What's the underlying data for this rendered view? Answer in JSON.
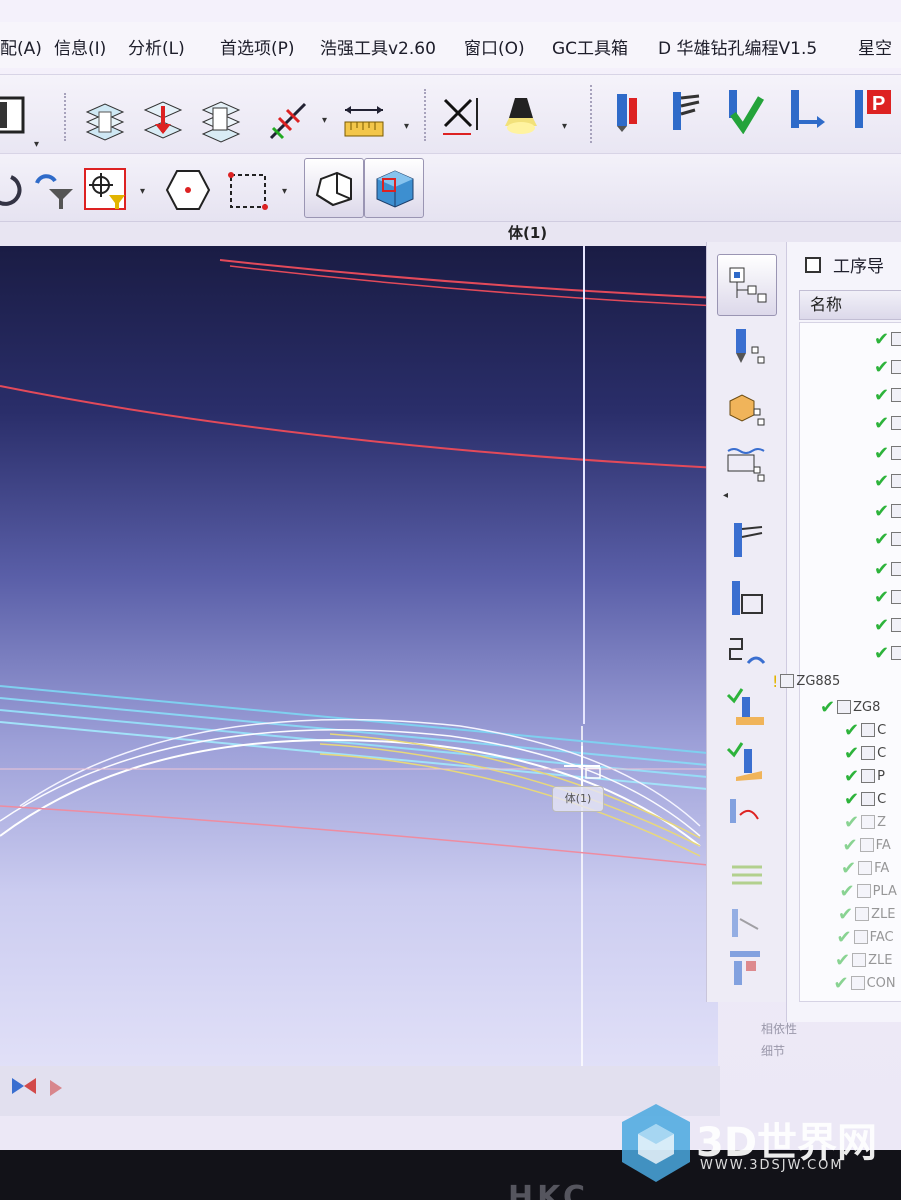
{
  "menu": {
    "items": [
      {
        "label": "配(A)"
      },
      {
        "label": "信息(I)"
      },
      {
        "label": "分析(L)"
      },
      {
        "label": "首选项(P)"
      },
      {
        "label": "浩强工具v2.60"
      },
      {
        "label": "窗口(O)"
      },
      {
        "label": "GC工具箱"
      },
      {
        "label": "D 华雄钻孔编程V1.5"
      },
      {
        "label": "星空"
      }
    ]
  },
  "toolbar_icons": {
    "row1": [
      "view-layers-icon",
      "point-down-icon",
      "layers-stack-icon",
      "dimension-tool-icon",
      "ruler-icon",
      "coordinate-axis-icon",
      "light-icon",
      "tool-blue-icon",
      "tool-flag-icon",
      "tool-check-icon",
      "tool-arrow-icon",
      "tool-p-icon"
    ],
    "row2": [
      "undo-icon",
      "filter-icon",
      "snap-point-icon",
      "hexagon-point-icon",
      "rectangle-select-icon",
      "shaded-edges-icon",
      "shaded-cube-icon"
    ]
  },
  "title_strip": {
    "text": "体(1)"
  },
  "viewport": {
    "tooltip": "体(1)"
  },
  "navigator": {
    "title": "工序导",
    "column_header": "名称",
    "rows": [
      {
        "text": "",
        "state": "check"
      },
      {
        "text": "",
        "state": "check"
      },
      {
        "text": "",
        "state": "check"
      },
      {
        "text": "",
        "state": "check"
      },
      {
        "text": "",
        "state": "check"
      },
      {
        "text": "",
        "state": "check"
      },
      {
        "text": "",
        "state": "check"
      },
      {
        "text": "",
        "state": "check"
      },
      {
        "text": "",
        "state": "check"
      },
      {
        "text": "",
        "state": "check"
      },
      {
        "text": "",
        "state": "check"
      },
      {
        "text": "",
        "state": "check"
      },
      {
        "text": "ZG885",
        "state": "bulb"
      },
      {
        "text": "ZG8",
        "state": "check"
      },
      {
        "text": "C",
        "state": "check"
      },
      {
        "text": "C",
        "state": "check"
      },
      {
        "text": "P",
        "state": "check"
      },
      {
        "text": "C",
        "state": "check"
      },
      {
        "text": "Z",
        "state": "check"
      },
      {
        "text": "FA",
        "state": "check"
      },
      {
        "text": "FA",
        "state": "check"
      },
      {
        "text": "PLA",
        "state": "check"
      },
      {
        "text": "ZLE",
        "state": "check"
      },
      {
        "text": "FAC",
        "state": "check"
      },
      {
        "text": "ZLE",
        "state": "check"
      },
      {
        "text": "CON",
        "state": "check"
      }
    ],
    "footer1": "相依性",
    "footer2": "细节"
  },
  "watermark": {
    "brand": "3D世界网",
    "url": "WWW.3DSJW.COM"
  },
  "bezel": {
    "logo": "HKC"
  }
}
